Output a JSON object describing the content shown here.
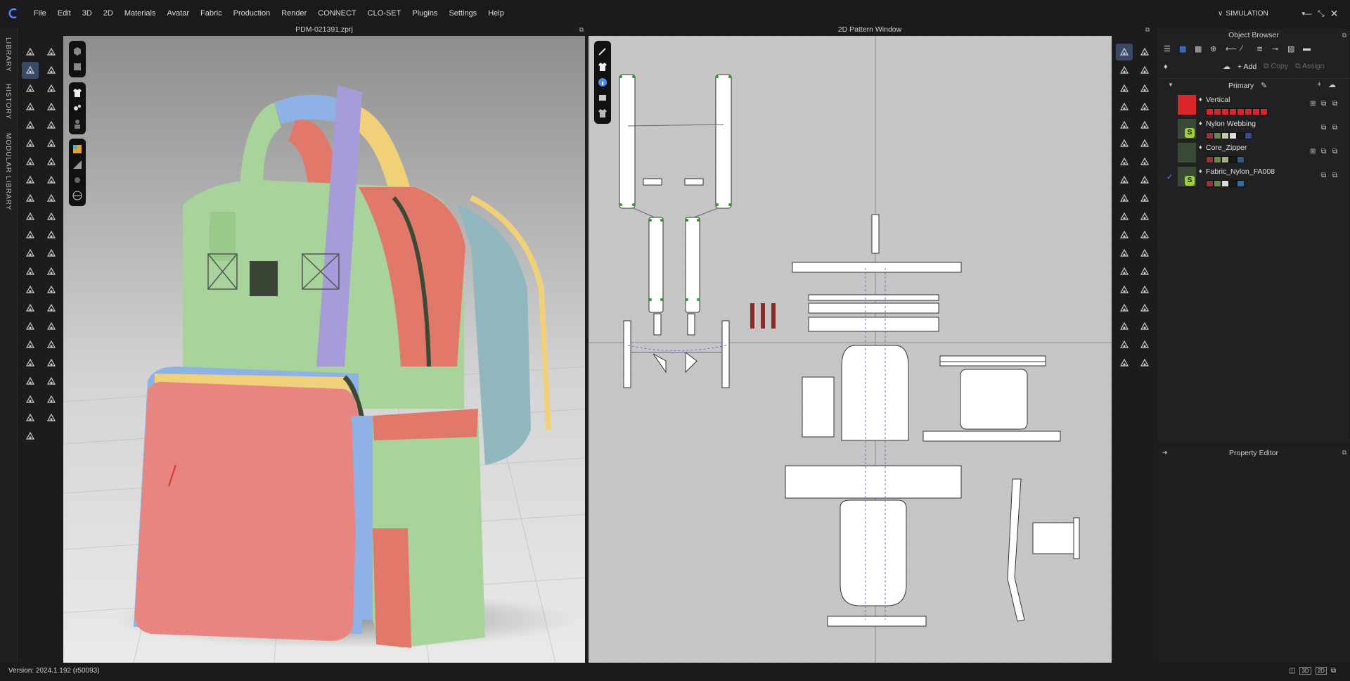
{
  "menu": {
    "items": [
      "File",
      "Edit",
      "3D",
      "2D",
      "Materials",
      "Avatar",
      "Fabric",
      "Production",
      "Render",
      "CONNECT",
      "CLO-SET",
      "Plugins",
      "Settings",
      "Help"
    ],
    "mode_label": "SIMULATION"
  },
  "left_dock": {
    "tabs": [
      "LIBRARY",
      "HISTORY",
      "MODULAR LIBRARY"
    ]
  },
  "viewport3d": {
    "title": "PDM-021391.zprj"
  },
  "viewport2d": {
    "title": "2D Pattern Window"
  },
  "object_browser": {
    "title": "Object Browser",
    "add_label": "Add",
    "copy_label": "Copy",
    "assign_label": "Assign",
    "group_label": "Primary",
    "materials": [
      {
        "name": "Vertical",
        "thumb_color": "#d8262b"
      },
      {
        "name": "Nylon Webbing",
        "thumb_color": "#3a4a36"
      },
      {
        "name": "Core_Zipper",
        "thumb_color": "#3a4a36"
      },
      {
        "name": "Fabric_Nylon_FA008",
        "thumb_color": "#3a4a36"
      }
    ]
  },
  "property_editor": {
    "title": "Property Editor"
  },
  "status": {
    "version": "Version: 2024.1.192 (r50093)"
  },
  "colors": {
    "accent": "#4c8cff",
    "bag_green": "#a8d39b",
    "bag_red": "#e2786a",
    "bag_blue": "#8fb2e6",
    "bag_yellow": "#f1d07a",
    "bag_purple": "#a79bd9",
    "bag_teal": "#8fb7bd"
  }
}
